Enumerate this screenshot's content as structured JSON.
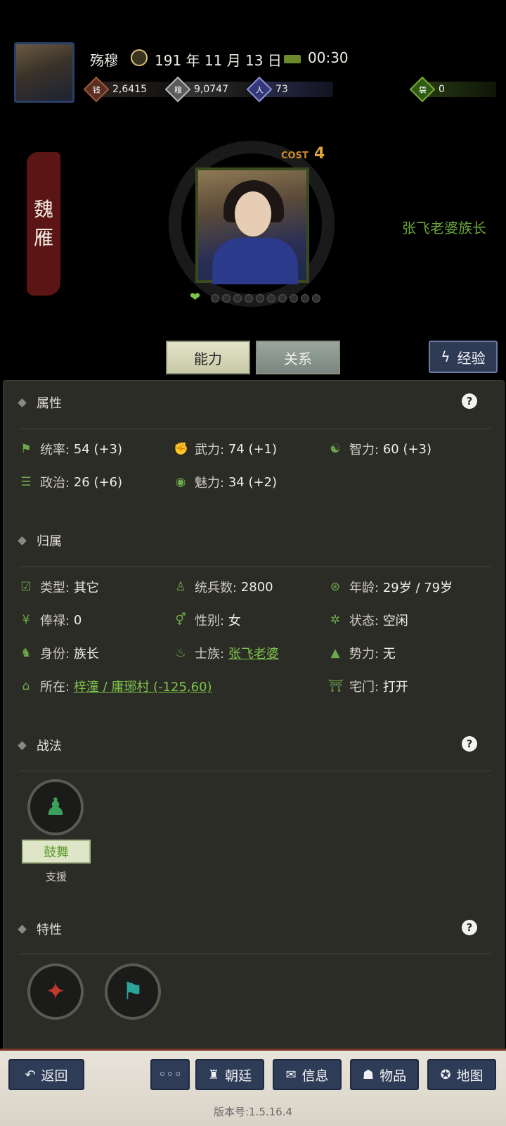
{
  "header": {
    "player_name": "殇穆",
    "date": "191 年 11 月 13 日",
    "time": "00:30",
    "resources": [
      {
        "name": "copper-coins",
        "value": "2,6415",
        "color": "#7a3d2a"
      },
      {
        "name": "grain",
        "value": "9,0747",
        "color": "#8a8a8a"
      },
      {
        "name": "population",
        "value": "73",
        "color": "#3b3f8a"
      },
      {
        "name": "bag",
        "value": "0",
        "color": "#3a6a1a"
      }
    ]
  },
  "hero": {
    "name_chars": [
      "魏",
      "雁"
    ],
    "cost_label": "COST",
    "cost_value": "4",
    "clan_title": "张飞老婆族长",
    "loyalty_dots": 10
  },
  "tabs": {
    "ability": "能力",
    "relation": "关系",
    "experience": "经验"
  },
  "attributes": {
    "title": "属性",
    "help": "?",
    "items": [
      {
        "label": "统率:",
        "value": "54 (+3)",
        "icon": "flag-icon"
      },
      {
        "label": "武力:",
        "value": "74 (+1)",
        "icon": "fist-icon"
      },
      {
        "label": "智力:",
        "value": "60 (+3)",
        "icon": "brain-icon"
      },
      {
        "label": "政治:",
        "value": "26 (+6)",
        "icon": "scroll-icon"
      },
      {
        "label": "魅力:",
        "value": "34 (+2)",
        "icon": "eye-icon"
      }
    ]
  },
  "belonging": {
    "title": "归属",
    "items": [
      {
        "label": "类型:",
        "value": "其它",
        "icon": "calendar-check-icon"
      },
      {
        "label": "统兵数:",
        "value": "2800",
        "icon": "soldier-icon"
      },
      {
        "label": "年龄:",
        "value": "29岁 / 79岁",
        "icon": "age-icon"
      },
      {
        "label": "俸禄:",
        "value": "0",
        "icon": "coin-icon"
      },
      {
        "label": "性别:",
        "value": "女",
        "icon": "gender-icon"
      },
      {
        "label": "状态:",
        "value": "空闲",
        "icon": "status-icon"
      },
      {
        "label": "身份:",
        "value": "族长",
        "icon": "identity-icon"
      },
      {
        "label": "士族:",
        "value": "张飞老婆",
        "icon": "clan-icon"
      },
      {
        "label": "势力:",
        "value": "无",
        "icon": "mountain-icon"
      },
      {
        "label": "所在:",
        "value": "梓潼 / 庸琊村 (-125,60)",
        "icon": "location-icon"
      },
      {
        "label": "宅门:",
        "value": "打开",
        "icon": "gate-icon"
      }
    ]
  },
  "tactics": {
    "title": "战法",
    "items": [
      {
        "name": "鼓舞",
        "type": "支援"
      }
    ]
  },
  "traits": {
    "title": "特性"
  },
  "bottom_bar": {
    "back": "返回",
    "more": "◦◦◦",
    "court": "朝廷",
    "info": "信息",
    "items": "物品",
    "map": "地图",
    "version": "版本号:1.5.16.4"
  }
}
